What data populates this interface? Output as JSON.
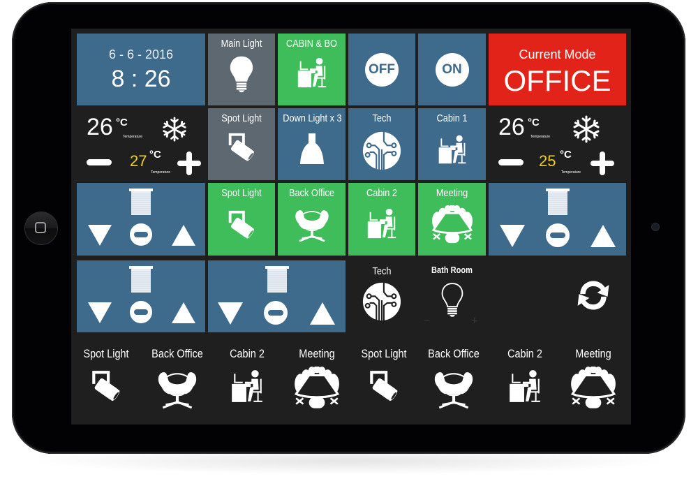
{
  "device": {
    "type": "tablet",
    "home_button": "home-button",
    "camera": "front-camera"
  },
  "colors": {
    "blue": "#3e6a8c",
    "gray": "#5d6871",
    "green": "#40bd5b",
    "red": "#e22319",
    "setpoint": "#f1d11a",
    "screen_bg": "#1f1f1f"
  },
  "clock": {
    "date": "6 - 6 - 2016",
    "time": "8 : 26"
  },
  "mode": {
    "label": "Current Mode",
    "value": "OFFICE"
  },
  "power": {
    "off_label": "OFF",
    "on_label": "ON"
  },
  "row1": {
    "main_light": {
      "label": "Main Light",
      "icon": "bulb-icon",
      "state": "off"
    },
    "cabin_bo": {
      "label": "CABIN & BO",
      "icon": "desk-person-icon",
      "state": "on"
    }
  },
  "row2": {
    "spot_light": {
      "label": "Spot Light",
      "icon": "spotlight-icon",
      "state": "off"
    },
    "down_light": {
      "label": "Down Light x 3",
      "icon": "pendant-lamp-icon"
    },
    "tech": {
      "label": "Tech",
      "icon": "circuit-icon"
    },
    "cabin1": {
      "label": "Cabin 1",
      "icon": "desk-person-icon"
    }
  },
  "climate": [
    {
      "current": "26",
      "unit": "°C",
      "current_caption": "Temperature",
      "setpoint": "27",
      "setpoint_unit": "°C",
      "setpoint_caption": "Temperature",
      "mode_icon": "snowflake-icon"
    },
    {
      "current": "26",
      "unit": "°C",
      "current_caption": "Temperature",
      "setpoint": "25",
      "setpoint_unit": "°C",
      "setpoint_caption": "Temperature",
      "mode_icon": "snowflake-icon"
    }
  ],
  "row3": {
    "spot_light": {
      "label": "Spot Light",
      "icon": "spotlight-icon",
      "state": "on"
    },
    "back_office": {
      "label": "Back Office",
      "icon": "swan-chair-icon",
      "state": "on"
    },
    "cabin2": {
      "label": "Cabin 2",
      "icon": "desk-person-icon",
      "state": "on"
    },
    "meeting": {
      "label": "Meeting",
      "icon": "conference-table-icon",
      "state": "on"
    }
  },
  "blinds": [
    {
      "down": "blind-down",
      "stop": "blind-stop",
      "up": "blind-up"
    },
    {
      "down": "blind-down",
      "stop": "blind-stop",
      "up": "blind-up"
    },
    {
      "down": "blind-down",
      "stop": "blind-stop",
      "up": "blind-up"
    },
    {
      "down": "blind-down",
      "stop": "blind-stop",
      "up": "blind-up"
    }
  ],
  "row4": {
    "tech": {
      "label": "Tech",
      "icon": "circuit-icon"
    },
    "bath_room": {
      "label": "Bath Room",
      "icon": "bulb-outline-icon",
      "minus": "−",
      "plus": "+"
    },
    "refresh": {
      "icon": "refresh-icon"
    }
  },
  "bottom": [
    {
      "label": "Spot Light",
      "icon": "spotlight-icon"
    },
    {
      "label": "Back Office",
      "icon": "swan-chair-icon"
    },
    {
      "label": "Cabin 2",
      "icon": "desk-person-icon"
    },
    {
      "label": "Meeting",
      "icon": "conference-table-icon"
    },
    {
      "label": "Spot Light",
      "icon": "spotlight-icon"
    },
    {
      "label": "Back Office",
      "icon": "swan-chair-icon"
    },
    {
      "label": "Cabin 2",
      "icon": "desk-person-icon"
    },
    {
      "label": "Meeting",
      "icon": "conference-table-icon"
    }
  ]
}
